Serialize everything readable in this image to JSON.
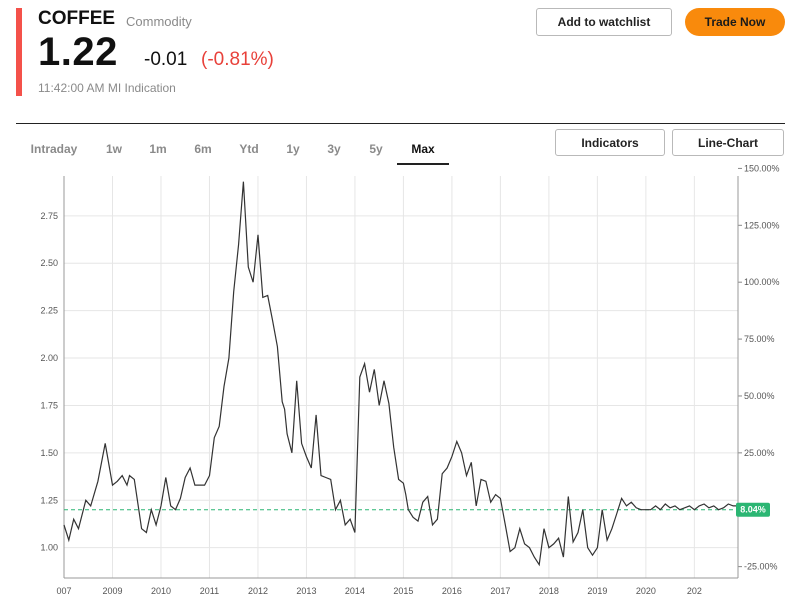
{
  "header": {
    "title": "COFFEE",
    "category": "Commodity",
    "price": "1.22",
    "change": "-0.01",
    "change_pct": "(-0.81%)",
    "timestamp": "11:42:00 AM MI Indication",
    "watchlist_label": "Add to watchlist",
    "trade_label": "Trade Now",
    "accent_color": "#f4514a",
    "trade_color": "#f98a0c",
    "negative_color": "#e8413a"
  },
  "tabs": [
    {
      "label": "Intraday",
      "active": false
    },
    {
      "label": "1w",
      "active": false
    },
    {
      "label": "1m",
      "active": false
    },
    {
      "label": "6m",
      "active": false
    },
    {
      "label": "Ytd",
      "active": false
    },
    {
      "label": "1y",
      "active": false
    },
    {
      "label": "3y",
      "active": false
    },
    {
      "label": "5y",
      "active": false
    },
    {
      "label": "Max",
      "active": true
    }
  ],
  "controls": {
    "indicators_label": "Indicators",
    "chart_type_label": "Line-Chart"
  },
  "chart_data": {
    "type": "line",
    "x_ticks": [
      "007",
      "2009",
      "2010",
      "2011",
      "2012",
      "2013",
      "2014",
      "2015",
      "2016",
      "2017",
      "2018",
      "2019",
      "2020",
      "202"
    ],
    "y_ticks_left": [
      "1.00",
      "1.25",
      "1.50",
      "1.75",
      "2.00",
      "2.25",
      "2.50",
      "2.75"
    ],
    "y_ticks_right": [
      "-25.00%",
      "0.00%",
      "25.00%",
      "50.00%",
      "75.00%",
      "100.00%",
      "125.00%",
      "150.00%"
    ],
    "ylim": [
      0.84,
      2.96
    ],
    "xlim": [
      2007.0,
      2020.9
    ],
    "reference_value": 1.2,
    "reference_label": "8.04%",
    "reference_color": "#2bb673",
    "line_color": "#333333",
    "grid": true,
    "series": [
      {
        "x": [
          2007.0,
          2007.1,
          2007.2,
          2007.3,
          2007.45,
          2007.55,
          2007.7,
          2007.85,
          2008.0,
          2008.1,
          2008.2,
          2008.3,
          2008.35,
          2008.45,
          2008.6,
          2008.7,
          2008.8,
          2008.9,
          2009.0,
          2009.1,
          2009.2,
          2009.3,
          2009.4,
          2009.5,
          2009.6,
          2009.7,
          2009.8,
          2009.9,
          2010.0,
          2010.1,
          2010.2,
          2010.3,
          2010.4,
          2010.5,
          2010.6,
          2010.7,
          2010.8,
          2010.9,
          2011.0,
          2011.1,
          2011.2,
          2011.3,
          2011.4,
          2011.5,
          2011.55,
          2011.6,
          2011.7,
          2011.8,
          2011.9,
          2012.0,
          2012.1,
          2012.2,
          2012.3,
          2012.4,
          2012.5,
          2012.6,
          2012.7,
          2012.8,
          2012.9,
          2013.0,
          2013.1,
          2013.2,
          2013.3,
          2013.4,
          2013.5,
          2013.6,
          2013.7,
          2013.8,
          2013.9,
          2014.0,
          2014.05,
          2014.1,
          2014.2,
          2014.3,
          2014.4,
          2014.5,
          2014.6,
          2014.7,
          2014.8,
          2014.9,
          2015.0,
          2015.1,
          2015.2,
          2015.3,
          2015.4,
          2015.5,
          2015.6,
          2015.7,
          2015.8,
          2015.9,
          2016.0,
          2016.1,
          2016.2,
          2016.3,
          2016.4,
          2016.5,
          2016.6,
          2016.7,
          2016.8,
          2016.9,
          2017.0,
          2017.1,
          2017.2,
          2017.3,
          2017.4,
          2017.5,
          2017.6,
          2017.7,
          2017.8,
          2017.9,
          2018.0,
          2018.1,
          2018.2,
          2018.3,
          2018.4,
          2018.5,
          2018.6,
          2018.7,
          2018.8,
          2018.9,
          2019.0,
          2019.1,
          2019.2,
          2019.3,
          2019.4,
          2019.5,
          2019.6,
          2019.7,
          2019.8,
          2019.9,
          2020.0,
          2020.1,
          2020.2,
          2020.3,
          2020.4,
          2020.5,
          2020.6,
          2020.7,
          2020.8,
          2020.9
        ],
        "y": [
          1.12,
          1.04,
          1.15,
          1.1,
          1.25,
          1.22,
          1.35,
          1.55,
          1.33,
          1.35,
          1.38,
          1.33,
          1.38,
          1.36,
          1.1,
          1.08,
          1.2,
          1.12,
          1.22,
          1.37,
          1.22,
          1.2,
          1.26,
          1.37,
          1.42,
          1.33,
          1.33,
          1.33,
          1.38,
          1.58,
          1.64,
          1.85,
          2.0,
          2.35,
          2.6,
          2.93,
          2.48,
          2.4,
          2.65,
          2.32,
          2.33,
          2.2,
          2.06,
          1.77,
          1.73,
          1.6,
          1.5,
          1.88,
          1.55,
          1.48,
          1.42,
          1.7,
          1.38,
          1.37,
          1.36,
          1.2,
          1.25,
          1.12,
          1.15,
          1.08,
          1.9,
          1.97,
          1.82,
          1.94,
          1.75,
          1.88,
          1.76,
          1.53,
          1.36,
          1.34,
          1.28,
          1.2,
          1.16,
          1.14,
          1.24,
          1.27,
          1.12,
          1.15,
          1.39,
          1.42,
          1.48,
          1.56,
          1.5,
          1.38,
          1.45,
          1.22,
          1.36,
          1.35,
          1.24,
          1.28,
          1.26,
          1.12,
          0.98,
          1.0,
          1.1,
          1.02,
          1.0,
          0.95,
          0.91,
          1.1,
          1.0,
          1.02,
          1.05,
          0.95,
          1.27,
          1.03,
          1.08,
          1.2,
          1.0,
          0.96,
          1.0,
          1.2,
          1.04,
          1.1,
          1.18,
          1.26,
          1.22,
          1.24,
          1.21,
          1.2,
          1.2,
          1.2,
          1.22,
          1.2,
          1.23,
          1.21,
          1.22,
          1.2,
          1.21,
          1.22,
          1.2,
          1.22,
          1.23,
          1.21,
          1.22,
          1.2,
          1.21,
          1.23,
          1.22,
          1.22
        ]
      }
    ]
  }
}
